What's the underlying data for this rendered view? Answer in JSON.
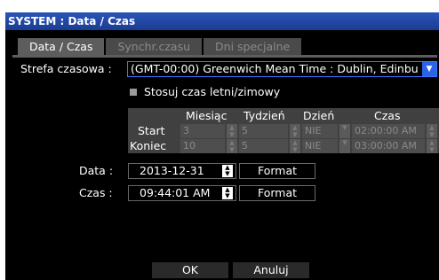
{
  "window": {
    "title": "SYSTEM : Data / Czas"
  },
  "tabs": [
    "Data / Czas",
    "Synchr.czasu",
    "Dni specjalne"
  ],
  "timezone": {
    "label": "Strefa czasowa :",
    "value": "(GMT-00:00) Greenwich Mean Time : Dublin, Edinbu"
  },
  "dst": {
    "checkbox_label": "Stosuj czas letni/zimowy",
    "checked": false,
    "headers": [
      "Miesiąc",
      "Tydzień",
      "Dzień",
      "Czas"
    ],
    "rows": [
      {
        "label": "Start",
        "month": "3",
        "week": "5",
        "day": "NIE",
        "time": "02:00:00 AM"
      },
      {
        "label": "Koniec",
        "month": "10",
        "week": "5",
        "day": "NIE",
        "time": "03:00:00 AM"
      }
    ]
  },
  "date": {
    "label": "Data :",
    "value": "2013-12-31",
    "format_button": "Format"
  },
  "time": {
    "label": "Czas :",
    "value": "09:44:01 AM",
    "format_button": "Format"
  },
  "footer": {
    "ok": "OK",
    "cancel": "Anuluj"
  },
  "colors": {
    "title_bar": "#1f47a8",
    "select_accent": "#2a63e8",
    "background": "#000000"
  }
}
